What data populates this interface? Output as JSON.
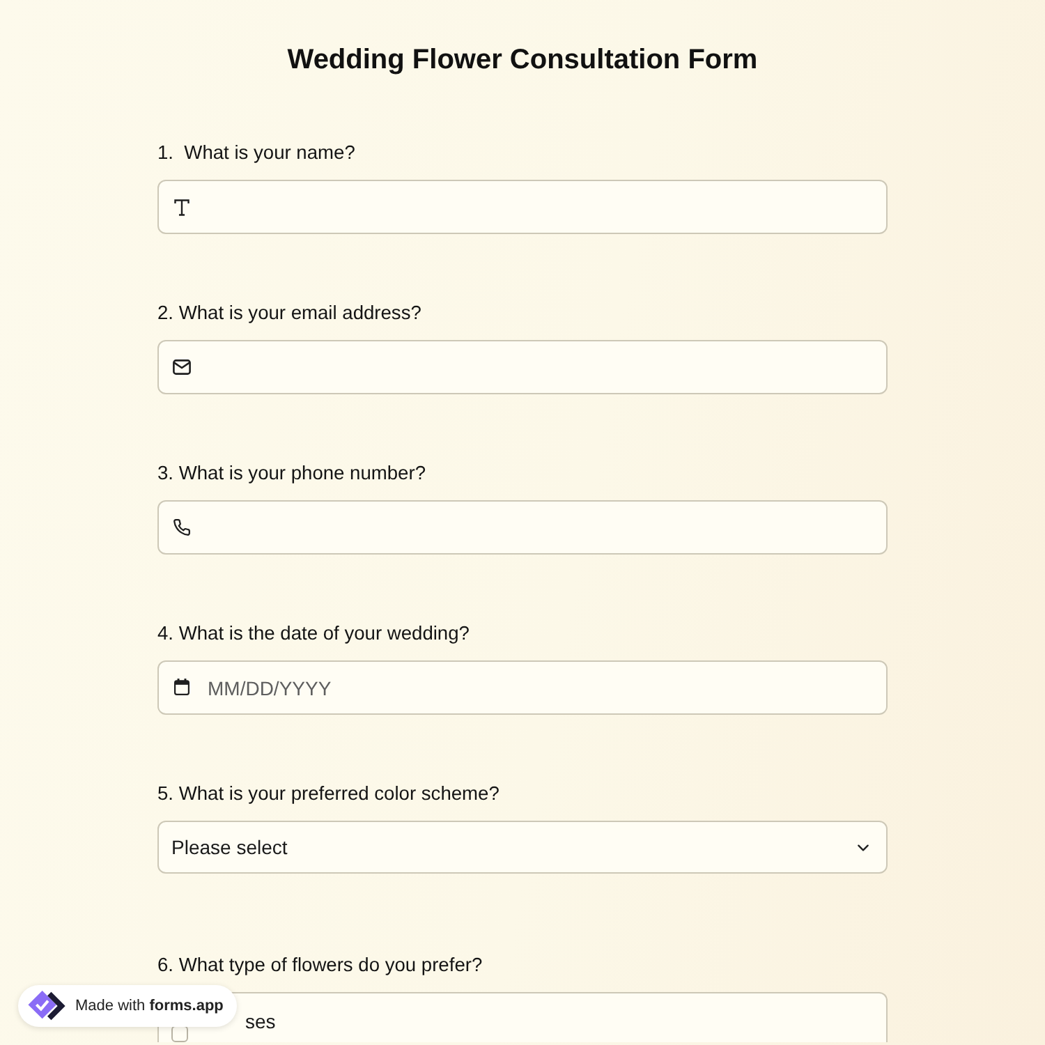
{
  "title": "Wedding Flower Consultation Form",
  "questions": [
    {
      "label": "1.  What is your name?",
      "kind": "text"
    },
    {
      "label": "2. What is your email address?",
      "kind": "email"
    },
    {
      "label": "3. What is your phone number?",
      "kind": "phone"
    },
    {
      "label": "4. What is the date of your wedding?",
      "kind": "date",
      "placeholder": "MM/DD/YYYY"
    },
    {
      "label": "5. What is your preferred color scheme?",
      "kind": "select",
      "placeholder": "Please select"
    },
    {
      "label": "6. What type of flowers do you prefer?",
      "kind": "checkboxes",
      "options": [
        {
          "label": "ses",
          "checked": false
        }
      ]
    }
  ],
  "badge": {
    "text": "Made with **forms.app**"
  }
}
